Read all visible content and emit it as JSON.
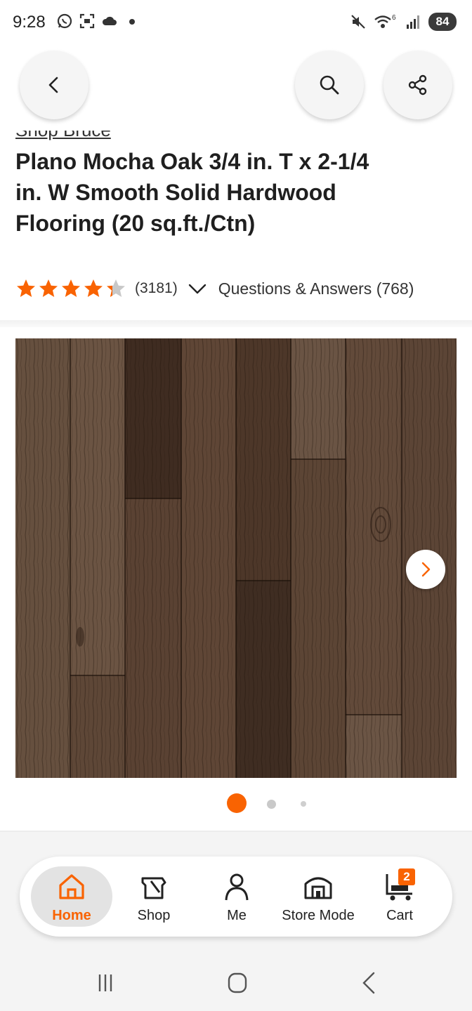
{
  "status_bar": {
    "time": "9:28",
    "battery": "84",
    "left_icons": [
      "whatsapp-icon",
      "screenshot-icon",
      "cloud-icon",
      "dot-icon"
    ],
    "right_icons": [
      "mute-icon",
      "wifi-icon",
      "signal-icon"
    ],
    "wifi_label": "6"
  },
  "header": {
    "brand_link": "Shop Bruce",
    "title": "Plano Mocha Oak 3/4 in. T x 2-1/4 in. W Smooth Solid Hardwood Flooring (20 sq.ft./Ctn)",
    "rating": 4.3,
    "rating_max": 5,
    "review_count": "(3181)",
    "qa_link": "Questions & Answers (768)"
  },
  "gallery": {
    "image_count": 3,
    "active_index": 0
  },
  "bottom_nav": {
    "items": [
      {
        "label": "Home",
        "icon": "home-icon",
        "active": true
      },
      {
        "label": "Shop",
        "icon": "shop-icon",
        "active": false
      },
      {
        "label": "Me",
        "icon": "person-icon",
        "active": false
      },
      {
        "label": "Store Mode",
        "icon": "store-icon",
        "active": false
      },
      {
        "label": "Cart",
        "icon": "cart-icon",
        "active": false
      }
    ],
    "cart_count": "2"
  },
  "colors": {
    "accent": "#f96302",
    "text": "#1f1f1f",
    "star_empty": "#c8c8c8"
  }
}
